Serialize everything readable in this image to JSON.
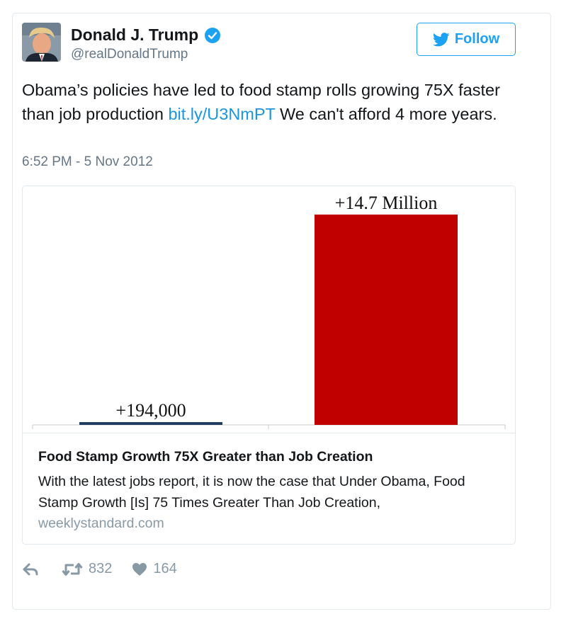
{
  "user": {
    "name": "Donald J. Trump",
    "handle": "@realDonaldTrump"
  },
  "follow": {
    "label": "Follow"
  },
  "tweet": {
    "text_before_link": "Obama’s policies have led to food stamp rolls growing 75X faster than job production ",
    "link": "bit.ly/U3NmPT",
    "text_after_link": " We can't afford 4 more years.",
    "timestamp": "6:52 PM - 5 Nov 2012"
  },
  "embed": {
    "title": "Food Stamp Growth 75X Greater than Job Creation",
    "description": "With the latest jobs report, it is now the case that Under Obama, Food Stamp Growth [Is] 75 Times Greater Than Job Creation,",
    "domain": "weeklystandard.com"
  },
  "chart_data": {
    "type": "bar",
    "categories": [
      "",
      ""
    ],
    "values": [
      194000,
      14700000
    ],
    "data_labels": [
      "+194,000",
      "+14.7 Million"
    ],
    "colors": [
      "#1f3a5f",
      "#c00000"
    ],
    "title": "",
    "xlabel": "",
    "ylabel": "",
    "ylim": [
      0,
      14700000
    ],
    "grid": false
  },
  "actions": {
    "retweets": "832",
    "likes": "164"
  },
  "colors": {
    "accent": "#1da1f2",
    "link": "#1b95e0",
    "muted": "#657786"
  },
  "icons": [
    "avatar",
    "verified-badge-icon",
    "bird-icon",
    "reply-icon",
    "retweet-icon",
    "heart-icon"
  ]
}
